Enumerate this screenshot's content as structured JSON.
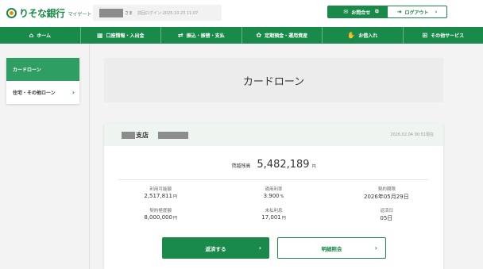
{
  "header": {
    "logo_text": "りそな銀行",
    "logo_sub": "マイゲート",
    "user_suffix": "さま",
    "last_login": "前回ログイン:2025.10.23 11:07",
    "contact_label": "お問合せ",
    "logout_label": "ログアウト"
  },
  "nav": {
    "items": [
      {
        "label": "ホーム"
      },
      {
        "label": "口座情報・入出金"
      },
      {
        "label": "振込・振替・支払"
      },
      {
        "label": "定期預金・運用資産"
      },
      {
        "label": "お借入れ"
      },
      {
        "label": "その他サービス"
      }
    ]
  },
  "sidebar": {
    "items": [
      {
        "label": "カードローン"
      },
      {
        "label": "住宅・その他ローン"
      }
    ]
  },
  "main": {
    "title": "カードローン",
    "branch_suffix": "支店",
    "as_of": "2026.02.04 00:51現在",
    "balance_label": "貸越残高",
    "balance_value": "5,482,189",
    "balance_unit": "円",
    "details": [
      {
        "label": "利用可能額",
        "value": "2,517,811",
        "unit": "円"
      },
      {
        "label": "適用利率",
        "value": "3.900",
        "unit": "%"
      },
      {
        "label": "契約期限",
        "value": "2026年05月29日",
        "unit": ""
      },
      {
        "label": "契約極度額",
        "value": "8,000,000",
        "unit": "円"
      },
      {
        "label": "未払利息",
        "value": "17,001",
        "unit": "円"
      },
      {
        "label": "返済日",
        "value": "05日",
        "unit": ""
      }
    ],
    "repay_label": "返済する",
    "detail_label": "明細照会"
  },
  "colors": {
    "brand_green": "#1a8a4a",
    "sidebar_active": "#2e9e62"
  },
  "icons": {
    "contact": "envelope-icon",
    "logout": "logout-icon"
  }
}
